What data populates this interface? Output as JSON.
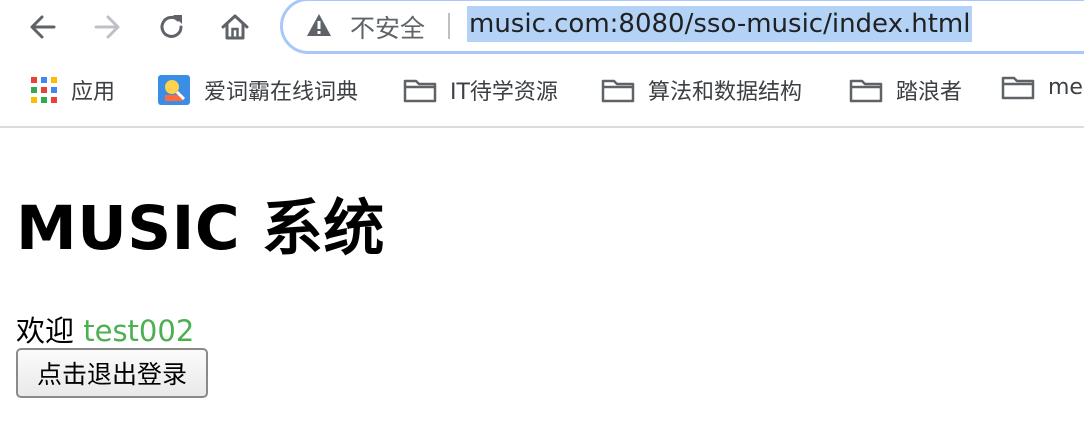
{
  "browser": {
    "security_text": "不安全",
    "url": "music.com:8080/sso-music/index.html",
    "back_icon": "back-arrow-icon",
    "forward_icon": "forward-arrow-icon",
    "reload_icon": "reload-icon",
    "home_icon": "home-icon",
    "warning_icon": "warning-triangle-icon"
  },
  "bookmarks": [
    {
      "label": "应用",
      "icon": "apps-grid-icon"
    },
    {
      "label": "爱词霸在线词典",
      "icon": "iciba-favicon"
    },
    {
      "label": "IT待学资源",
      "icon": "folder-icon"
    },
    {
      "label": "算法和数据结构",
      "icon": "folder-icon"
    },
    {
      "label": "踏浪者",
      "icon": "folder-icon"
    },
    {
      "label": "me",
      "icon": "folder-icon"
    }
  ],
  "page": {
    "title": "MUSIC 系统",
    "welcome_prefix": "欢迎",
    "username": "test002",
    "logout_button": "点击退出登录"
  },
  "colors": {
    "username": "#4caf50",
    "url_selection": "#b4d2f5",
    "omnibox_border": "#a8c7fa"
  }
}
